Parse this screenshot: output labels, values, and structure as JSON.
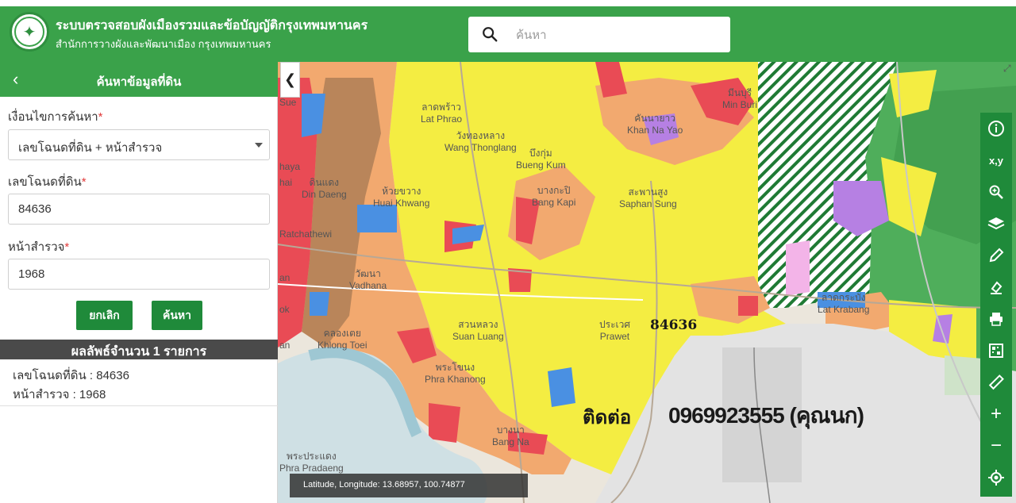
{
  "header": {
    "title": "ระบบตรวจสอบผังเมืองรวมและข้อบัญญัติกรุงเทพมหานคร",
    "subtitle": "สำนักการวางผังและพัฒนาเมือง กรุงเทพมหานคร",
    "search_placeholder": "ค้นหา"
  },
  "sidebar": {
    "title": "ค้นหาข้อมูลที่ดิน",
    "condition_label": "เงื่อนไขการค้นหา",
    "condition_value": "เลขโฉนดที่ดิน + หน้าสำรวจ",
    "deed_label": "เลขโฉนดที่ดิน",
    "deed_value": "84636",
    "survey_label": "หน้าสำรวจ",
    "survey_value": "1968",
    "required_mark": "*",
    "cancel_label": "ยกเลิก",
    "search_label": "ค้นหา",
    "result_title": "ผลลัพธ์จำนวน 1 รายการ",
    "result_deed": "เลขโฉนดที่ดิน : 84636",
    "result_survey": "หน้าสำรวจ : 1968"
  },
  "map": {
    "parcel_label": "84636",
    "contact_text": "ติดต่อ",
    "phone_text": "0969923555 (คุณนก)",
    "coordinates": "Latitude, Longitude: 13.68957, 100.74877",
    "places": [
      {
        "th": "ลาดพร้าว",
        "en": "Lat Phrao"
      },
      {
        "th": "วังทองหลาง",
        "en": "Wang Thonglang"
      },
      {
        "th": "บึงกุ่ม",
        "en": "Bueng Kum"
      },
      {
        "th": "คันนายาว",
        "en": "Khan Na Yao"
      },
      {
        "th": "มีนบุรี",
        "en": "Min Buri"
      },
      {
        "th": "ดินแดง",
        "en": "Din Daeng"
      },
      {
        "th": "ห้วยขวาง",
        "en": "Huai Khwang"
      },
      {
        "th": "บางกะปิ",
        "en": "Bang Kapi"
      },
      {
        "th": "สะพานสูง",
        "en": "Saphan Sung"
      },
      {
        "th": "วัฒนา",
        "en": "Vadhana"
      },
      {
        "th": "สวนหลวง",
        "en": "Suan Luang"
      },
      {
        "th": "ประเวศ",
        "en": "Prawet"
      },
      {
        "th": "ลาดกระบัง",
        "en": "Lat Krabang"
      },
      {
        "th": "คลองเตย",
        "en": "Khlong Toei"
      },
      {
        "th": "พระโขนง",
        "en": "Phra Khanong"
      },
      {
        "th": "บางนา",
        "en": "Bang Na"
      },
      {
        "th": "พระประแดง",
        "en": "Phra Pradaeng"
      }
    ],
    "edge_labels": [
      "Sue",
      "haya",
      "hai",
      "Ratchathewi",
      "an",
      "ok",
      "an"
    ]
  },
  "toolbar": {
    "items": [
      "info-icon",
      "xy-icon",
      "zoom-area-icon",
      "layers-icon",
      "pencil-icon",
      "eraser-icon",
      "print-icon",
      "qr-icon",
      "ruler-icon",
      "zoom-in-icon",
      "zoom-out-icon",
      "locate-icon"
    ],
    "xy_label": "x,y"
  }
}
